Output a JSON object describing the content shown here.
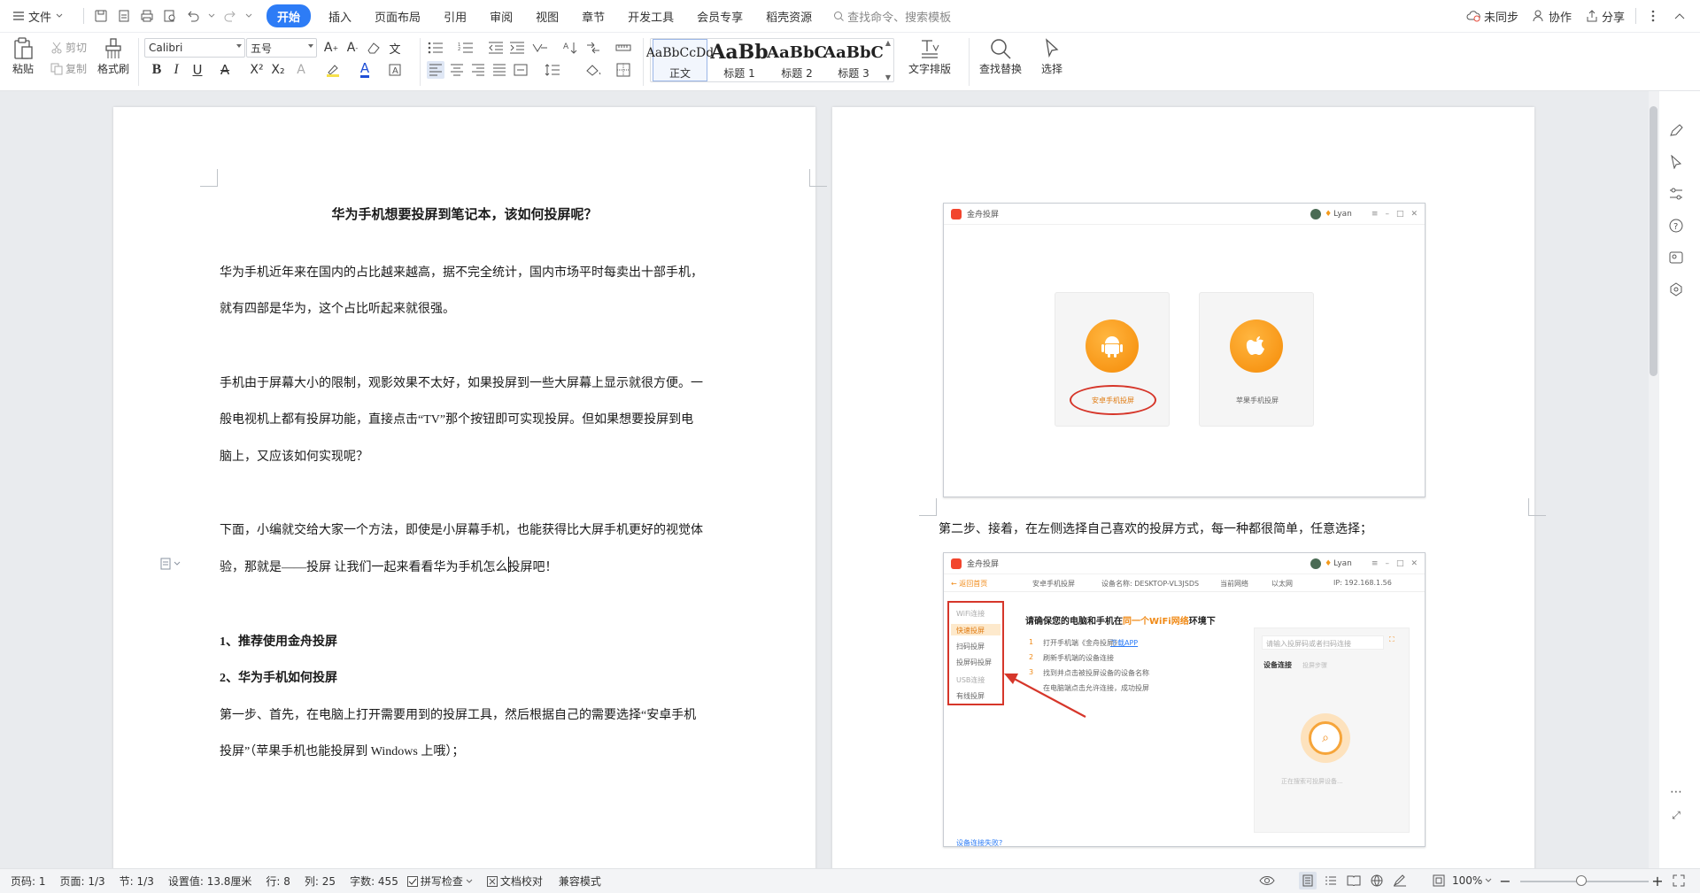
{
  "menubar": {
    "file_label": "文件",
    "tabs": [
      "开始",
      "插入",
      "页面布局",
      "引用",
      "审阅",
      "视图",
      "章节",
      "开发工具",
      "会员专享",
      "稻壳资源"
    ],
    "search_placeholder": "查找命令、搜索模板",
    "sync_label": "未同步",
    "collab_label": "协作",
    "share_label": "分享"
  },
  "ribbon": {
    "paste": "粘贴",
    "cut": "剪切",
    "copy": "复制",
    "format_painter": "格式刷",
    "font_name": "Calibri",
    "font_size": "五号",
    "styles": [
      {
        "preview": "AaBbCcDd",
        "label": "正文"
      },
      {
        "preview": "AaBb",
        "label": "标题 1"
      },
      {
        "preview": "AaBbC",
        "label": "标题 2"
      },
      {
        "preview": "AaBbC",
        "label": "标题 3"
      }
    ],
    "text_layout": "文字排版",
    "find_replace": "查找替换",
    "select": "选择"
  },
  "page1": {
    "title": "华为手机想要投屏到笔记本，该如何投屏呢？",
    "lines": [
      "华为手机近年来在国内的占比越来越高，据不完全统计，国内市场平时每卖出十部手机，",
      "就有四部是华为，这个占比听起来就很强。",
      "手机由于屏幕大小的限制，观影效果不太好，如果投屏到一些大屏幕上显示就很方便。一",
      "般电视机上都有投屏功能，直接点击“TV”那个按钮即可实现投屏。但如果想要投屏到电",
      "脑上，又应该如何实现呢？",
      "下面，小编就交给大家一个方法，即使是小屏幕手机，也能获得比大屏手机更好的视觉体",
      "验，那就是——投屏 让我们一起来看看华为手机怎么投屏吧！"
    ],
    "heading1": "1、推荐使用金舟投屏",
    "heading2": "2、华为手机如何投屏",
    "step1_lines": [
      "第一步、首先，在电脑上打开需要用到的投屏工具，然后根据自己的需要选择“安卓手机",
      "投屏”（苹果手机也能投屏到 Windows 上哦）；"
    ]
  },
  "page2": {
    "step2_text": "第二步、接着，在左侧选择自己喜欢的投屏方式，每一种都很简单，任意选择；",
    "shot1": {
      "app_title": "金舟投屏",
      "user": "Lyan",
      "android_label": "安卓手机投屏",
      "ios_label": "苹果手机投屏"
    },
    "shot2": {
      "app_title": "金舟投屏",
      "user": "Lyan",
      "back": "返回首页",
      "mode": "安卓手机投屏",
      "device_name": "设备名称: DESKTOP-VL3JSDS",
      "net": "当前网络",
      "lan": "以太网",
      "ip": "IP: 192.168.1.56",
      "wifi_group": "WiFi连接",
      "items": [
        "快速投屏",
        "扫码投屏",
        "投屏码投屏"
      ],
      "usb_group": "USB连接",
      "usb_item": "有线投屏",
      "headline_a": "请确保您的电脑和手机在",
      "headline_b": "同一个WiFi网络",
      "headline_c": "环境下",
      "steps": [
        "打开手机端《金舟投屏》",
        "刷新手机端的设备连接",
        "找到并点击被投屏设备的设备名称",
        "在电脑端点击允许连接，成功投屏"
      ],
      "download": "下载APP",
      "input_placeholder": "请输入投屏码或者扫码连接",
      "device_conn": "设备连接",
      "device_hint": "投屏步骤",
      "searching": "正在搜索可投屏设备...",
      "fail_link": "设备连接失败?"
    }
  },
  "status": {
    "page_code": "页码: 1",
    "pages": "页面: 1/3",
    "section": "节: 1/3",
    "setting": "设置值: 13.8厘米",
    "row": "行: 8",
    "col": "列: 25",
    "words": "字数: 455",
    "spell": "拼写检查",
    "proof": "文档校对",
    "compat": "兼容模式",
    "zoom": "100%"
  }
}
